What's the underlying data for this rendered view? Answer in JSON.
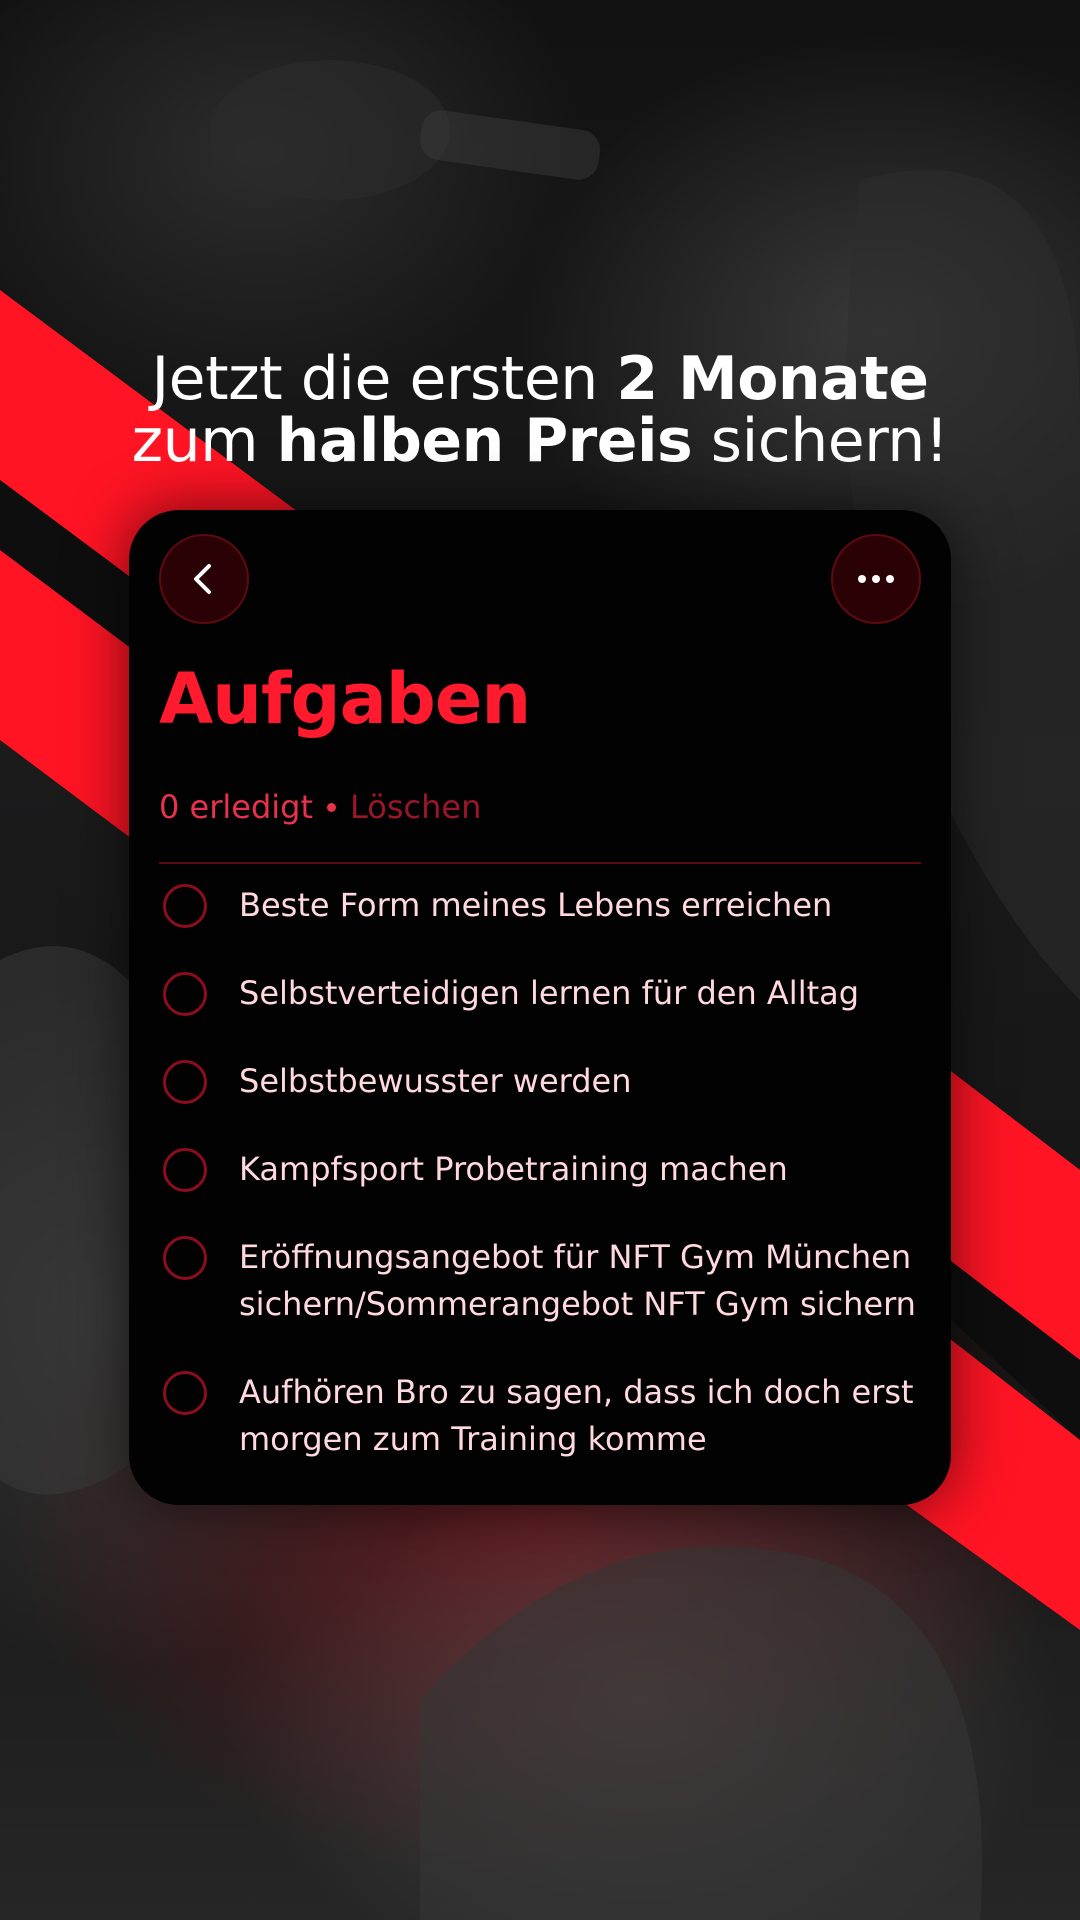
{
  "headline": {
    "line1_pre": "Jetzt die ersten ",
    "line1_bold": "2 Monate",
    "line2_pre": "zum ",
    "line2_bold": "halben Preis",
    "line2_post": " sichern!"
  },
  "colors": {
    "accent_red": "#ff1a2e",
    "card_background": "#020203",
    "task_text": "#ffd9de",
    "checkbox_border": "#8a0e1c",
    "button_fill": "#2a0206"
  },
  "card": {
    "back_icon": "chevron-left-icon",
    "more_icon": "more-horizontal-icon",
    "title": "Aufgaben",
    "done_count": "0 erledigt",
    "clear_label": "Löschen",
    "tasks": [
      {
        "label": "Beste Form meines Lebens erreichen",
        "done": false
      },
      {
        "label": "Selbstverteidigen lernen für den Alltag",
        "done": false
      },
      {
        "label": "Selbstbewusster werden",
        "done": false
      },
      {
        "label": "Kampfsport Probetraining machen",
        "done": false
      },
      {
        "label": "Eröffnungsangebot für NFT Gym München sichern/Sommerangebot NFT Gym sichern",
        "done": false
      },
      {
        "label": "Aufhören Bro zu sagen, dass ich doch erst morgen zum Training komme",
        "done": false
      }
    ]
  }
}
